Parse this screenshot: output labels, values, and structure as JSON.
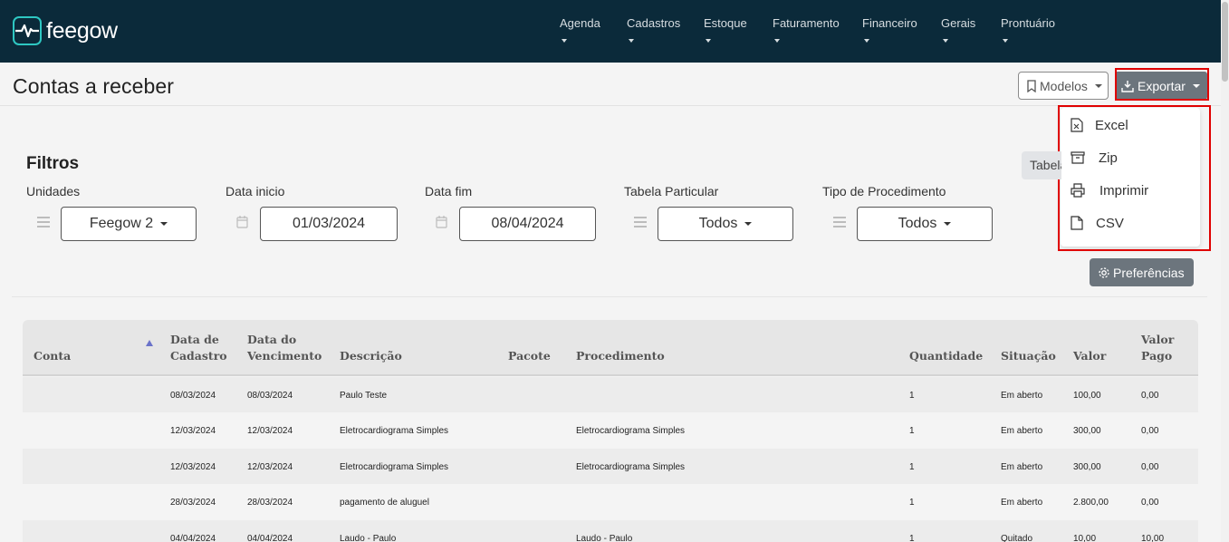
{
  "app": {
    "logo_text": "feegow"
  },
  "nav": {
    "items": [
      {
        "label": "Agenda"
      },
      {
        "label": "Cadastros"
      },
      {
        "label": "Estoque"
      },
      {
        "label": "Faturamento"
      },
      {
        "label": "Financeiro"
      },
      {
        "label": "Gerais"
      },
      {
        "label": "Prontuário"
      }
    ]
  },
  "header": {
    "title": "Contas a receber",
    "models_label": "Modelos",
    "export_label": "Exportar"
  },
  "export_menu": {
    "items": [
      {
        "label": "Excel",
        "icon": "excel-file-icon"
      },
      {
        "label": "Zip",
        "icon": "archive-icon"
      },
      {
        "label": "Imprimir",
        "icon": "printer-icon"
      },
      {
        "label": "CSV",
        "icon": "file-icon"
      }
    ]
  },
  "filters": {
    "title": "Filtros",
    "tab_partial": "Tabela",
    "unidades": {
      "label": "Unidades",
      "value": "Feegow 2"
    },
    "data_inicio": {
      "label": "Data inicio",
      "value": "01/03/2024"
    },
    "data_fim": {
      "label": "Data fim",
      "value": "08/04/2024"
    },
    "tabela_particular": {
      "label": "Tabela Particular",
      "value": "Todos"
    },
    "tipo_procedimento": {
      "label": "Tipo de Procedimento",
      "value": "Todos"
    },
    "preferences_label": "Preferências"
  },
  "table": {
    "headers": {
      "conta": "Conta",
      "data_cadastro_1": "Data de",
      "data_cadastro_2": "Cadastro",
      "data_vencimento_1": "Data do",
      "data_vencimento_2": "Vencimento",
      "descricao": "Descrição",
      "pacote": "Pacote",
      "procedimento": "Procedimento",
      "quantidade": "Quantidade",
      "situacao": "Situação",
      "valor": "Valor",
      "valor_pago_1": "Valor",
      "valor_pago_2": "Pago"
    },
    "rows": [
      {
        "conta": "",
        "cadastro": "08/03/2024",
        "vencimento": "08/03/2024",
        "descricao": "Paulo Teste",
        "pacote": "",
        "procedimento": "",
        "quantidade": "1",
        "situacao": "Em aberto",
        "valor": "100,00",
        "valor_pago": "0,00"
      },
      {
        "conta": "",
        "cadastro": "12/03/2024",
        "vencimento": "12/03/2024",
        "descricao": "Eletrocardiograma Simples",
        "pacote": "",
        "procedimento": "Eletrocardiograma Simples",
        "quantidade": "1",
        "situacao": "Em aberto",
        "valor": "300,00",
        "valor_pago": "0,00"
      },
      {
        "conta": "",
        "cadastro": "12/03/2024",
        "vencimento": "12/03/2024",
        "descricao": "Eletrocardiograma Simples",
        "pacote": "",
        "procedimento": "Eletrocardiograma Simples",
        "quantidade": "1",
        "situacao": "Em aberto",
        "valor": "300,00",
        "valor_pago": "0,00"
      },
      {
        "conta": "",
        "cadastro": "28/03/2024",
        "vencimento": "28/03/2024",
        "descricao": "pagamento de aluguel",
        "pacote": "",
        "procedimento": "",
        "quantidade": "1",
        "situacao": "Em aberto",
        "valor": "2.800,00",
        "valor_pago": "0,00"
      },
      {
        "conta": "",
        "cadastro": "04/04/2024",
        "vencimento": "04/04/2024",
        "descricao": "Laudo - Paulo",
        "pacote": "",
        "procedimento": "Laudo - Paulo",
        "quantidade": "1",
        "situacao": "Quitado",
        "valor": "10,00",
        "valor_pago": "10,00"
      }
    ]
  },
  "colors": {
    "topbar": "#0b2a3a",
    "accent": "#2ec7c2",
    "button_secondary": "#6c757d",
    "highlight": "#e00000"
  }
}
